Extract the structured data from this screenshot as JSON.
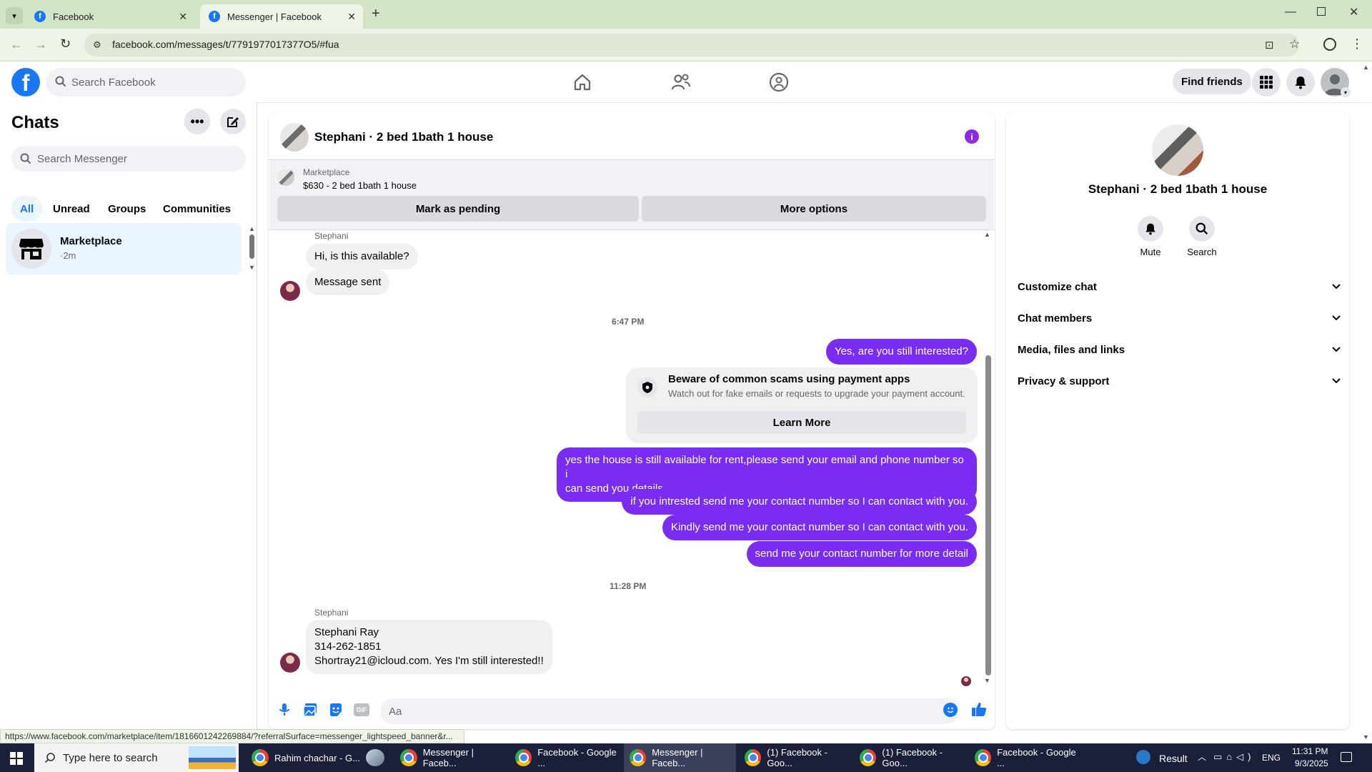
{
  "browser": {
    "tabs": [
      {
        "title": "Facebook",
        "active": false
      },
      {
        "title": "Messenger | Facebook",
        "active": true
      }
    ],
    "url": "facebook.com/messages/t/7791977017377O5/#fua",
    "status_url": "https://www.facebook.com/marketplace/item/1816601242269884/?referralSurface=messenger_lightspeed_banner&r..."
  },
  "fb_header": {
    "search_placeholder": "Search Facebook",
    "find_friends": "Find friends"
  },
  "left_panel": {
    "title": "Chats",
    "search_placeholder": "Search Messenger",
    "filters": [
      "All",
      "Unread",
      "Groups",
      "Communities"
    ],
    "active_filter": "All",
    "conversations": [
      {
        "name": "Marketplace",
        "time": "·2m"
      }
    ]
  },
  "chat": {
    "title": "Stephani · 2 bed 1bath 1 house",
    "banner": {
      "source": "Marketplace",
      "listing": "$630 - 2 bed 1bath 1 house",
      "mark_pending": "Mark as pending",
      "more_options": "More options"
    },
    "messages_top": {
      "sender": "Stephani",
      "m1": "Hi, is this available?",
      "m2": "Message sent"
    },
    "time1": "6:47 PM",
    "out1": "Yes, are you still interested?",
    "scam": {
      "title": "Beware of common scams using payment apps",
      "body": "Watch out for fake emails or requests to upgrade your payment account.",
      "learn_more": "Learn More"
    },
    "out2_line1": "yes the house is still available for rent,please send your email and phone number so i",
    "out2_line2": "can send you details",
    "out3": "if you intrested send me your contact number so I can contact with you.",
    "out4": "Kindly send me your contact number so I can contact with you.",
    "out5": "send me your contact number for more detail",
    "time2": "11:28 PM",
    "last": {
      "sender": "Stephani",
      "line1": "Stephani Ray",
      "line2": "314-262-1851",
      "line3": "Shortray21@icloud.com. Yes I'm still interested!!"
    },
    "composer_placeholder": "Aa"
  },
  "right_panel": {
    "title": "Stephani · 2 bed 1bath 1 house",
    "mute": "Mute",
    "search": "Search",
    "sections": [
      "Customize chat",
      "Chat members",
      "Media, files and links",
      "Privacy & support"
    ]
  },
  "taskbar": {
    "search_placeholder": "Type here to search",
    "items": [
      "Rahim chachar - G...",
      "Messenger | Faceb...",
      "Facebook - Google ...",
      "Messenger | Faceb...",
      "(1) Facebook - Goo...",
      "(1) Facebook - Goo...",
      "Facebook - Google ..."
    ],
    "result": "Result",
    "lang": "ENG",
    "time": "11:31 PM",
    "date": "9/3/2025"
  },
  "colors": {
    "accent": "#1877f2",
    "outgoing_bubble": "#7b2cf3",
    "info_icon": "#8a2be2"
  }
}
